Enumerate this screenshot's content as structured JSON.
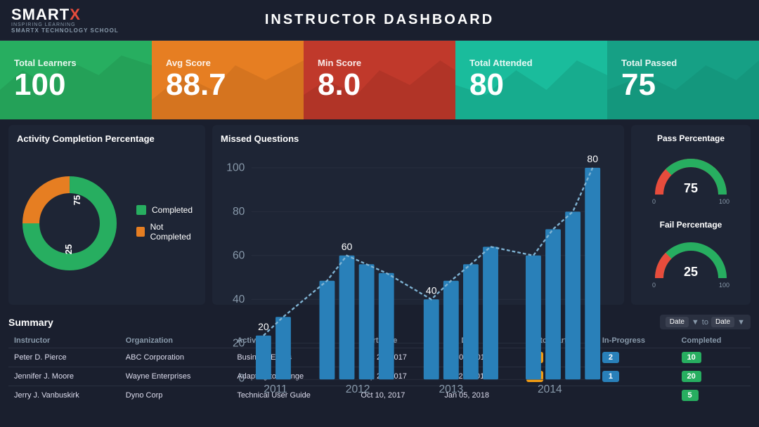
{
  "header": {
    "title": "INSTRUCTOR DASHBOARD",
    "logo_smart": "SMART",
    "logo_x": "X",
    "logo_tagline": "INSPIRING LEARNING",
    "logo_school": "SMARTX TECHNOLOGY SCHOOL"
  },
  "stat_cards": [
    {
      "id": "total-learners",
      "label": "Total Learners",
      "value": "100",
      "color": "green"
    },
    {
      "id": "avg-score",
      "label": "Avg Score",
      "value": "88.7",
      "color": "orange"
    },
    {
      "id": "min-score",
      "label": "Min Score",
      "value": "8.0",
      "color": "red"
    },
    {
      "id": "total-attended",
      "label": "Total Attended",
      "value": "80",
      "color": "teal"
    },
    {
      "id": "total-passed",
      "label": "Total Passed",
      "value": "75",
      "color": "dark-teal"
    }
  ],
  "activity_completion": {
    "title": "Activity Completion Percentage",
    "completed_value": 75,
    "not_completed_value": 25,
    "completed_label": "Completed",
    "not_completed_label": "Not Completed",
    "completed_color": "#27ae60",
    "not_completed_color": "#e67e22"
  },
  "missed_questions": {
    "title": "Missed Questions",
    "y_max": 100,
    "bars": [
      {
        "year": "2011",
        "value": 20
      },
      {
        "year": "2011b",
        "value": 28
      },
      {
        "year": "2012",
        "value": 45
      },
      {
        "year": "2012b",
        "value": 60
      },
      {
        "year": "2012c",
        "value": 55
      },
      {
        "year": "2012d",
        "value": 50
      },
      {
        "year": "2013",
        "value": 40
      },
      {
        "year": "2013b",
        "value": 45
      },
      {
        "year": "2013c",
        "value": 55
      },
      {
        "year": "2013d",
        "value": 65
      },
      {
        "year": "2014",
        "value": 60
      },
      {
        "year": "2014b",
        "value": 70
      },
      {
        "year": "2014c",
        "value": 75
      },
      {
        "year": "2014d",
        "value": 80
      }
    ],
    "x_labels": [
      "2011",
      "2012",
      "2013",
      "2014"
    ],
    "y_labels": [
      "0",
      "20",
      "40",
      "60",
      "80",
      "100"
    ],
    "annotations": [
      {
        "bar_index": 0,
        "label": "20"
      },
      {
        "bar_index": 3,
        "label": "60"
      },
      {
        "bar_index": 6,
        "label": "40"
      },
      {
        "bar_index": 13,
        "label": "80"
      }
    ]
  },
  "pass_percentage": {
    "title": "Pass Percentage",
    "value": 75,
    "color": "#27ae60",
    "min": "0",
    "max": "100"
  },
  "fail_percentage": {
    "title": "Fail Percentage",
    "value": 25,
    "color": "#e74c3c",
    "min": "0",
    "max": "100"
  },
  "summary": {
    "title": "Summary",
    "date_filter": {
      "label_from": "Date",
      "label_arrow": "▼",
      "label_to": "to",
      "label_to_date": "Date",
      "label_to_arrow": "▼"
    },
    "columns": [
      "Instructor",
      "Organization",
      "Activity",
      "Start Date",
      "End Date",
      "Yet to Start",
      "In-Progress",
      "Completed"
    ],
    "rows": [
      {
        "instructor": "Peter D. Pierce",
        "organization": "ABC Corporation",
        "activity": "Business Ethics",
        "start_date": "Dec 26, 2017",
        "end_date": "Jan 05, 2018",
        "yet_to_start": "2",
        "yet_color": "yellow",
        "in_progress": "2",
        "in_color": "blue",
        "completed": "10",
        "comp_color": "green"
      },
      {
        "instructor": "Jennifer J. Moore",
        "organization": "Wayne Enterprises",
        "activity": "Adapting to change",
        "start_date": "Sep 20, 2017",
        "end_date": "Oct 27, 2017",
        "yet_to_start": "1",
        "yet_color": "yellow",
        "in_progress": "1",
        "in_color": "blue",
        "completed": "20",
        "comp_color": "green"
      },
      {
        "instructor": "Jerry J. Vanbuskirk",
        "organization": "Dyno Corp",
        "activity": "Technical User Guide",
        "start_date": "Oct 10, 2017",
        "end_date": "Jan 05, 2018",
        "yet_to_start": "",
        "yet_color": "yellow",
        "in_progress": "",
        "in_color": "blue",
        "completed": "5",
        "comp_color": "green"
      }
    ]
  }
}
